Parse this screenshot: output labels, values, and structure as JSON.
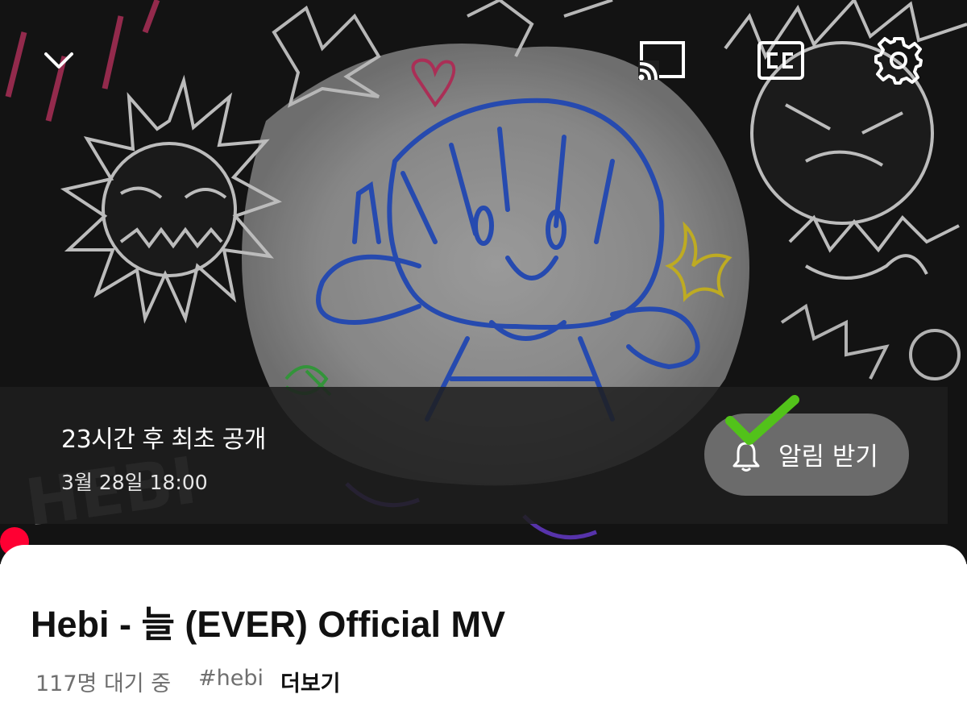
{
  "player": {
    "controls": {
      "collapse_icon": "chevron-down-icon",
      "cast_icon": "cast-icon",
      "captions_icon": "closed-captions-icon",
      "captions_text": "CC",
      "settings_icon": "gear-icon"
    },
    "premiere": {
      "title": "23시간 후 최초 공개",
      "date": "3월 28일 18:00",
      "notify_label": "알림 받기",
      "notify_icon": "bell-icon",
      "check_icon": "checkmark-icon"
    },
    "progress_color": "#ff0033",
    "artwork_text": "HEBI"
  },
  "video": {
    "title": "Hebi - 늘 (EVER) Official MV",
    "waiting": "117명 대기 중",
    "hashtag": "#hebi",
    "more_label": "더보기"
  },
  "colors": {
    "accent_red": "#ff0033",
    "check_green": "#52c21a",
    "overlay": "#1e1e1e"
  }
}
